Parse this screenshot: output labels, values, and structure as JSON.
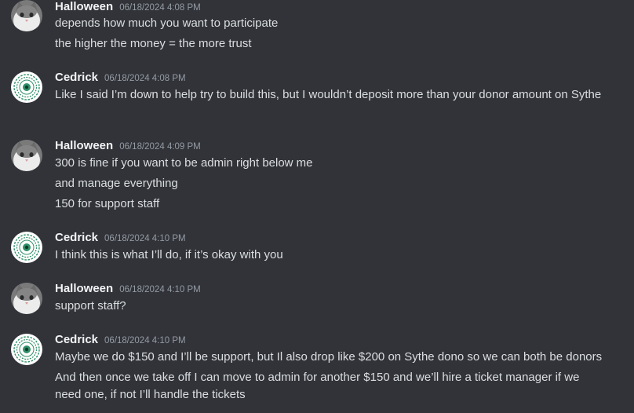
{
  "groups": [
    {
      "author": "Halloween",
      "avatar": "cat-avatar",
      "timestamp": "06/18/2024 4:08 PM",
      "lines": [
        "depends how much you want to participate",
        "the higher the money = the more trust"
      ]
    },
    {
      "author": "Cedrick",
      "avatar": "mandala-avatar",
      "timestamp": "06/18/2024 4:08 PM",
      "lines": [
        "Like I said I’m down to help try to build this, but I wouldn’t deposit more than your donor amount on Sythe"
      ]
    },
    {
      "author": "Halloween",
      "avatar": "cat-avatar",
      "timestamp": "06/18/2024 4:09 PM",
      "lines": [
        "300 is fine if you want to be admin right below me",
        "and manage everything",
        "150 for support staff"
      ]
    },
    {
      "author": "Cedrick",
      "avatar": "mandala-avatar",
      "timestamp": "06/18/2024 4:10 PM",
      "lines": [
        "I think this is what I’ll do, if it’s okay with you"
      ]
    },
    {
      "author": "Halloween",
      "avatar": "cat-avatar",
      "timestamp": "06/18/2024 4:10 PM",
      "lines": [
        "support staff?"
      ]
    },
    {
      "author": "Cedrick",
      "avatar": "mandala-avatar",
      "timestamp": "06/18/2024 4:10 PM",
      "lines": [
        "Maybe we do $150 and I’ll be support, but Il also drop like $200 on Sythe dono so we can both be donors",
        "And then once we take off I can move to admin for another $150 and we’ll hire a ticket manager if we need one, if not I’ll handle the tickets"
      ]
    }
  ],
  "colors": {
    "background": "#313338",
    "username": "#f2f3f5",
    "timestamp": "#949ba4",
    "message_text": "#dbdee1"
  }
}
